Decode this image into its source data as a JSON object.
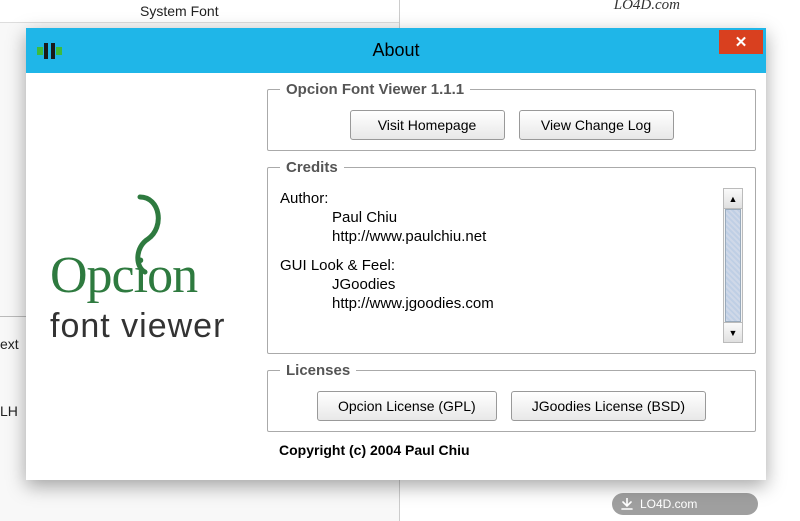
{
  "background": {
    "list_item": "System Font",
    "partial_text_left1": "ext",
    "partial_text_left2": "LH",
    "top_right_watermark": "LO4D.com"
  },
  "dialog": {
    "title": "About",
    "close_icon_char": "✕",
    "logo_line1": "Opcion",
    "logo_line2": "font viewer"
  },
  "section_homepage": {
    "legend": "Opcion Font Viewer 1.1.1",
    "buttons": {
      "visit": "Visit Homepage",
      "changelog": "View Change Log"
    }
  },
  "section_credits": {
    "legend": "Credits",
    "author_label": "Author:",
    "author_name": "Paul Chiu",
    "author_url": "http://www.paulchiu.net",
    "gui_label": "GUI Look & Feel:",
    "gui_name": "JGoodies",
    "gui_url": "http://www.jgoodies.com"
  },
  "section_licenses": {
    "legend": "Licenses",
    "buttons": {
      "opcion": "Opcion License (GPL)",
      "jgoodies": "JGoodies License (BSD)"
    }
  },
  "copyright": "Copyright (c) 2004 Paul Chiu",
  "badge": {
    "text": "LO4D.com"
  }
}
